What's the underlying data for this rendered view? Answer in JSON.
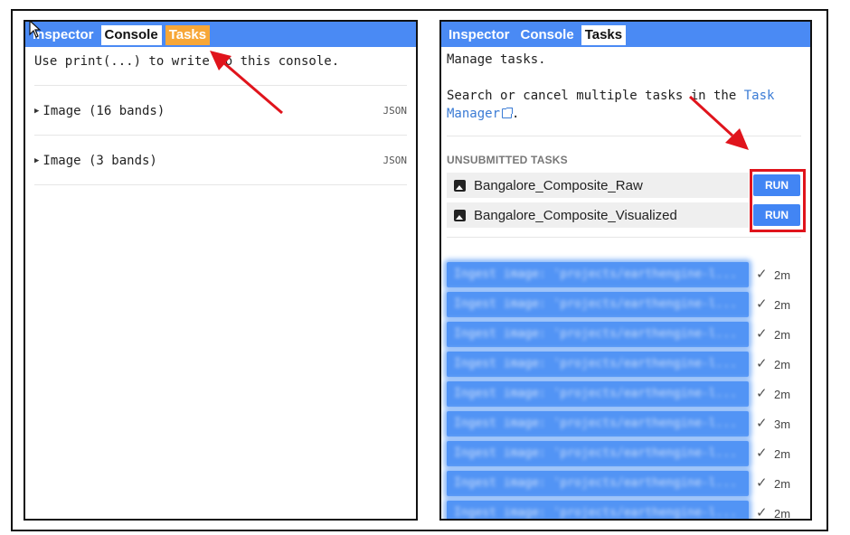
{
  "left_panel": {
    "tabs": [
      {
        "label": "Inspector"
      },
      {
        "label": "Console"
      },
      {
        "label": "Tasks"
      }
    ],
    "console_message": "Use print(...) to write to this console.",
    "rows": [
      {
        "label": "Image (16 bands)",
        "tag": "JSON"
      },
      {
        "label": "Image (3 bands)",
        "tag": "JSON"
      }
    ]
  },
  "right_panel": {
    "tabs": [
      {
        "label": "Inspector"
      },
      {
        "label": "Console"
      },
      {
        "label": "Tasks"
      }
    ],
    "manage_text": "Manage tasks.",
    "search_text": "Search or cancel multiple tasks in the",
    "task_manager_link": "Task Manager",
    "period": ".",
    "section_header": "UNSUBMITTED TASKS",
    "unsubmitted_tasks": [
      {
        "name": "Bangalore_Composite_Raw",
        "button": "RUN"
      },
      {
        "name": "Bangalore_Composite_Visualized",
        "button": "RUN"
      }
    ],
    "completed_tasks": [
      {
        "label": "Ingest image: 'projects/earthengine-l...",
        "time": "2m"
      },
      {
        "label": "Ingest image: 'projects/earthengine-l...",
        "time": "2m"
      },
      {
        "label": "Ingest image: 'projects/earthengine-l...",
        "time": "2m"
      },
      {
        "label": "Ingest image: 'projects/earthengine-l...",
        "time": "2m"
      },
      {
        "label": "Ingest image: 'projects/earthengine-l...",
        "time": "2m"
      },
      {
        "label": "Ingest image: 'projects/earthengine-l...",
        "time": "3m"
      },
      {
        "label": "Ingest image: 'projects/earthengine-l...",
        "time": "2m"
      },
      {
        "label": "Ingest image: 'projects/earthengine-l...",
        "time": "2m"
      },
      {
        "label": "Ingest image: 'projects/earthengine-l...",
        "time": "2m"
      }
    ]
  },
  "colors": {
    "tab_bar": "#4a8af4",
    "tasks_tab_highlight": "#f7a738",
    "run_button": "#4285f4",
    "annotation_red": "#e0141c"
  },
  "icons": {
    "tree_toggle": "triangle-right-icon",
    "external_link": "open-in-new-icon",
    "task_type": "image-icon",
    "completed": "check-icon"
  }
}
